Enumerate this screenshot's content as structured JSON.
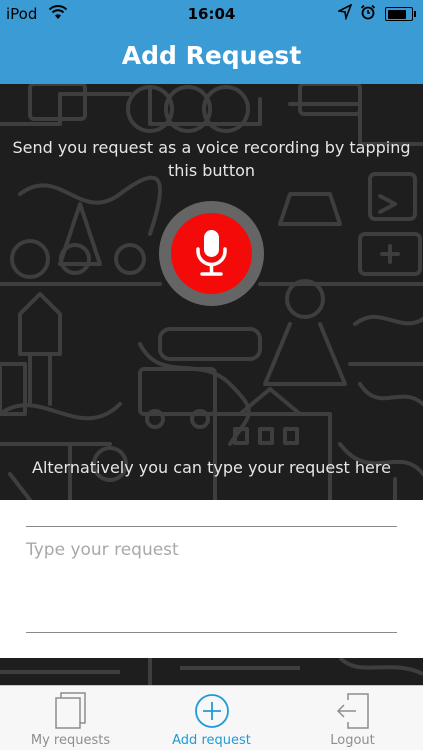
{
  "status_bar": {
    "carrier": "iPod",
    "time": "16:04",
    "battery_level": 0.9
  },
  "header": {
    "title": "Add Request"
  },
  "hero": {
    "voice_instruction": "Send you request as a voice recording  by tapping this button",
    "alternative_instruction": "Alternatively you can type your request here",
    "mic_icon": "microphone-icon"
  },
  "request_input": {
    "placeholder": "Type your request",
    "value": ""
  },
  "tabs": [
    {
      "label": "My requests",
      "icon": "documents-icon",
      "active": false
    },
    {
      "label": "Add request",
      "icon": "plus-circle-icon",
      "active": true
    },
    {
      "label": "Logout",
      "icon": "logout-icon",
      "active": false
    }
  ],
  "colors": {
    "accent": "#3a9bd5",
    "record_button": "#f50a0a",
    "active_tab": "#1f9bd7",
    "background_dark": "#1e1e1e"
  }
}
